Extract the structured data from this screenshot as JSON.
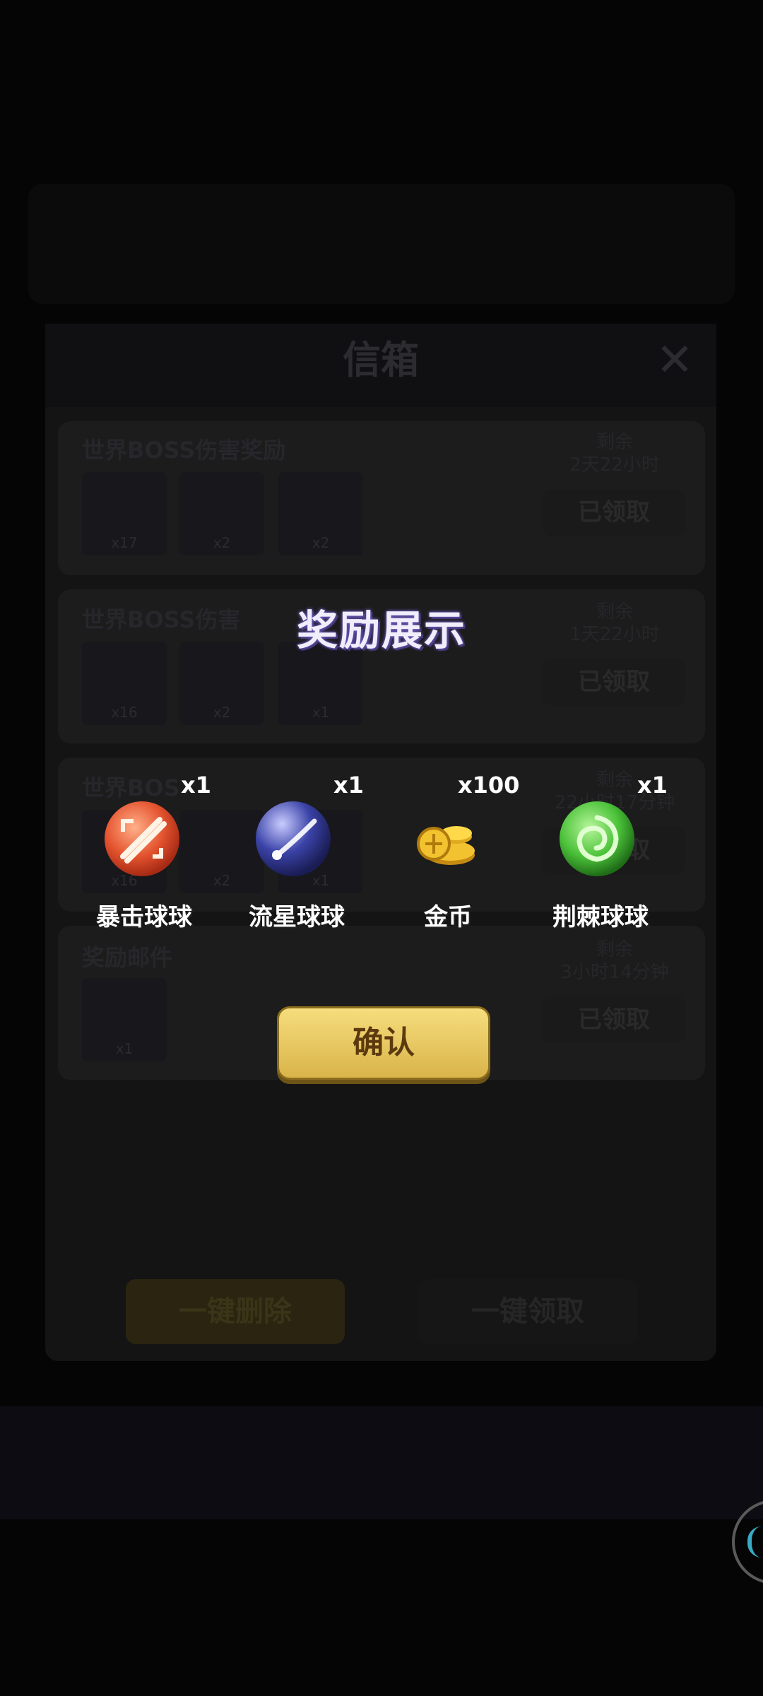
{
  "mailbox": {
    "title": "信箱",
    "close_symbol": "✕",
    "mails": [
      {
        "name": "世界BOSS伤害奖励",
        "remain_label": "剩余",
        "remain_time": "2天22小时",
        "button": "已领取",
        "items": [
          {
            "icon": "party-hat-icon",
            "count": "x17"
          },
          {
            "icon": "tag-icon",
            "count": "x2"
          },
          {
            "icon": "chest-icon",
            "count": "x2"
          }
        ]
      },
      {
        "name": "世界BOSS伤害",
        "remain_label": "剩余",
        "remain_time": "1天22小时",
        "button": "已领取",
        "items": [
          {
            "icon": "party-hat-icon",
            "count": "x16"
          },
          {
            "icon": "tag-icon",
            "count": "x2"
          },
          {
            "icon": "chest-icon",
            "count": "x1"
          }
        ]
      },
      {
        "name": "世界BOS",
        "remain_label": "剩余",
        "remain_time": "22小时17分钟",
        "button": "已领取",
        "items": [
          {
            "icon": "party-hat-icon",
            "count": "x16"
          },
          {
            "icon": "tag-icon",
            "count": "x2"
          },
          {
            "icon": "chest-icon",
            "count": "x1"
          }
        ]
      },
      {
        "name": "奖励邮件",
        "remain_label": "剩余",
        "remain_time": "3小时14分钟",
        "button": "已领取",
        "items": [
          {
            "icon": "gear-icon",
            "count": "x1"
          }
        ]
      }
    ],
    "delete_all": "一键删除",
    "claim_all": "一键领取"
  },
  "reward": {
    "title": "奖励展示",
    "items": [
      {
        "name": "暴击球球",
        "qty": "x1",
        "icon": "crit-ball-icon",
        "color": "#e4542f"
      },
      {
        "name": "流星球球",
        "qty": "x1",
        "icon": "meteor-ball-icon",
        "color": "#3b43a8"
      },
      {
        "name": "金币",
        "qty": "x100",
        "icon": "gold-coins-icon",
        "color": "#f2c230"
      },
      {
        "name": "荆棘球球",
        "qty": "x1",
        "icon": "thorn-ball-icon",
        "color": "#4cc23a"
      }
    ],
    "confirm": "确认"
  }
}
